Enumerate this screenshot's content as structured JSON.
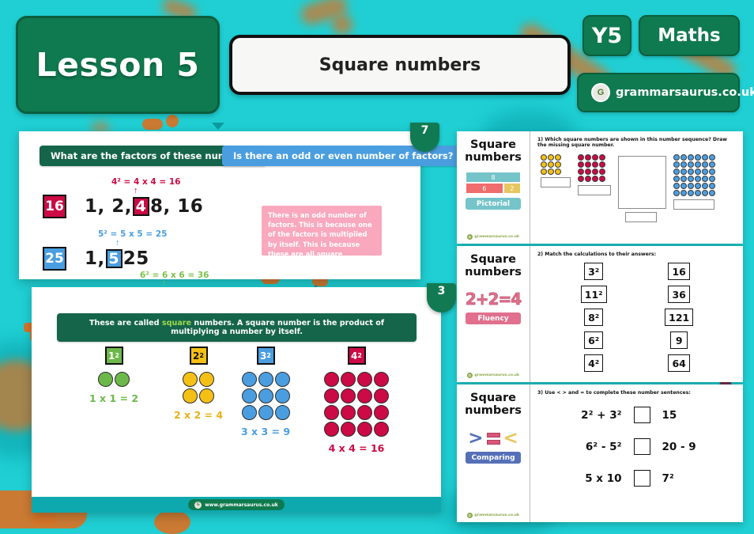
{
  "header": {
    "lesson_label": "Lesson 5",
    "title": "Square numbers",
    "year_badge": "Y5",
    "subject_badge": "Maths",
    "brand_text": "grammarsaurus.co.uk",
    "brand_logo_letter": "G"
  },
  "slide_one": {
    "page_number": "7",
    "banner_left": "What are the factors of these numbers?",
    "banner_right": "Is there an odd or even number of factors?",
    "rows": [
      {
        "chip": "16",
        "chip_color": "#cc0a45",
        "equation": "4² = 4 x 4 = 16",
        "factors_before": "1, 2,",
        "factors_highlight": "4",
        "factors_after": "8, 16"
      },
      {
        "chip": "25",
        "chip_color": "#4a9ee0",
        "equation": "5² = 5 x 5 = 25",
        "factors_before": "1,",
        "factors_highlight": "5",
        "factors_after": "25"
      }
    ],
    "third_equation": "6² = 6 x 6 = 36",
    "note": "There is an odd number of factors. This is because one of the factors is multiplied by itself. This is because these are all square numbers."
  },
  "slide_two": {
    "page_number": "3",
    "banner_pre": "These are called ",
    "banner_highlight": "square",
    "banner_post": " numbers.  A square number is the product of multiplying a number by itself.",
    "groups": [
      {
        "chip": "1",
        "exponent": "2",
        "color": "#6cb94a",
        "rows": 1,
        "cols": 2,
        "equation": "1 x 1 = 2"
      },
      {
        "chip": "2",
        "exponent": "2",
        "color": "#f5c016",
        "rows": 2,
        "cols": 2,
        "equation": "2 x 2 = 4"
      },
      {
        "chip": "3",
        "exponent": "2",
        "color": "#4a9ee0",
        "rows": 3,
        "cols": 3,
        "equation": "3 x 3 = 9"
      },
      {
        "chip": "4",
        "exponent": "2",
        "color": "#cc0a45",
        "rows": 4,
        "cols": 4,
        "equation": "4 x 4 = 16"
      }
    ],
    "footer_url": "www.grammarsaurus.co.uk",
    "footer_logo_letter": "G"
  },
  "worksheet": {
    "rows": [
      {
        "side_title_line1": "Square",
        "side_title_line2": "numbers",
        "badge_type": "bar-model",
        "bar_whole": "8",
        "bar_part_left": "6",
        "bar_part_right": "2",
        "pill_label": "Pictorial",
        "question": "1) Which square numbers are shown in this number sequence? Draw the missing square number.",
        "grids": [
          {
            "rows": 3,
            "cols": 3,
            "color": "#f5c016"
          },
          {
            "rows": 4,
            "cols": 4,
            "color": "#cc0a45"
          },
          {
            "rows": 0,
            "cols": 0,
            "color": ""
          },
          {
            "rows": 6,
            "cols": 6,
            "color": "#4a9ee0"
          }
        ],
        "footer_text": "grammarsaurus.co.uk"
      },
      {
        "side_title_line1": "Square",
        "side_title_line2": "numbers",
        "badge_type": "fluency",
        "fluency_equation": "2+2=4",
        "pill_label": "Fluency",
        "question": "2) Match the calculations to their answers:",
        "left_column": [
          "3²",
          "11²",
          "8²",
          "6²",
          "4²"
        ],
        "right_column": [
          "16",
          "36",
          "121",
          "9",
          "64"
        ],
        "footer_text": "grammarsaurus.co.uk"
      },
      {
        "side_title_line1": "Square",
        "side_title_line2": "numbers",
        "badge_type": "comparing",
        "pill_label": "Comparing",
        "question": "3) Use < > and = to complete these number sentences:",
        "sentences": [
          {
            "left": "2² + 3²",
            "right": "15"
          },
          {
            "left": "6² - 5²",
            "right": "20 - 9"
          },
          {
            "left": "5 x 10",
            "right": "7²"
          }
        ],
        "footer_text": "grammarsaurus.co.uk"
      }
    ]
  }
}
